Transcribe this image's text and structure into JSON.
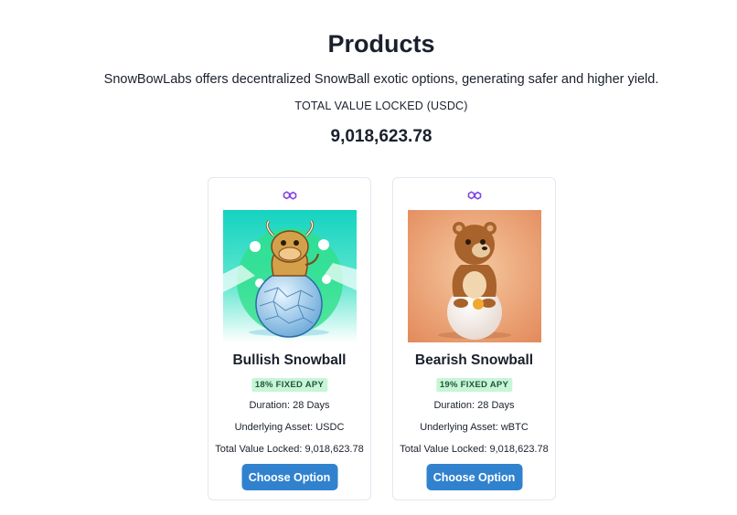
{
  "header": {
    "title": "Products",
    "subtitle": "SnowBowLabs offers decentralized SnowBall exotic options, generating safer and higher yield.",
    "tvl_label": "TOTAL VALUE LOCKED (USDC)",
    "tvl_value": "9,018,623.78"
  },
  "products": [
    {
      "name": "Bullish Snowball",
      "apy": "18% FIXED APY",
      "duration": "Duration: 28 Days",
      "underlying": "Underlying Asset: USDC",
      "tvl": "Total Value Locked: 9,018,623.78",
      "button": "Choose Option",
      "chain_icon": "polygon-icon",
      "image": "bull-on-snowball"
    },
    {
      "name": "Bearish Snowball",
      "apy": "19% FIXED APY",
      "duration": "Duration: 28 Days",
      "underlying": "Underlying Asset: wBTC",
      "tvl": "Total Value Locked: 9,018,623.78",
      "button": "Choose Option",
      "chain_icon": "polygon-icon",
      "image": "bear-on-snowball"
    }
  ],
  "colors": {
    "primary_button": "#3182ce",
    "badge_bg": "#c6f6d5",
    "badge_text": "#22543d",
    "polygon_purple": "#8247e5"
  }
}
